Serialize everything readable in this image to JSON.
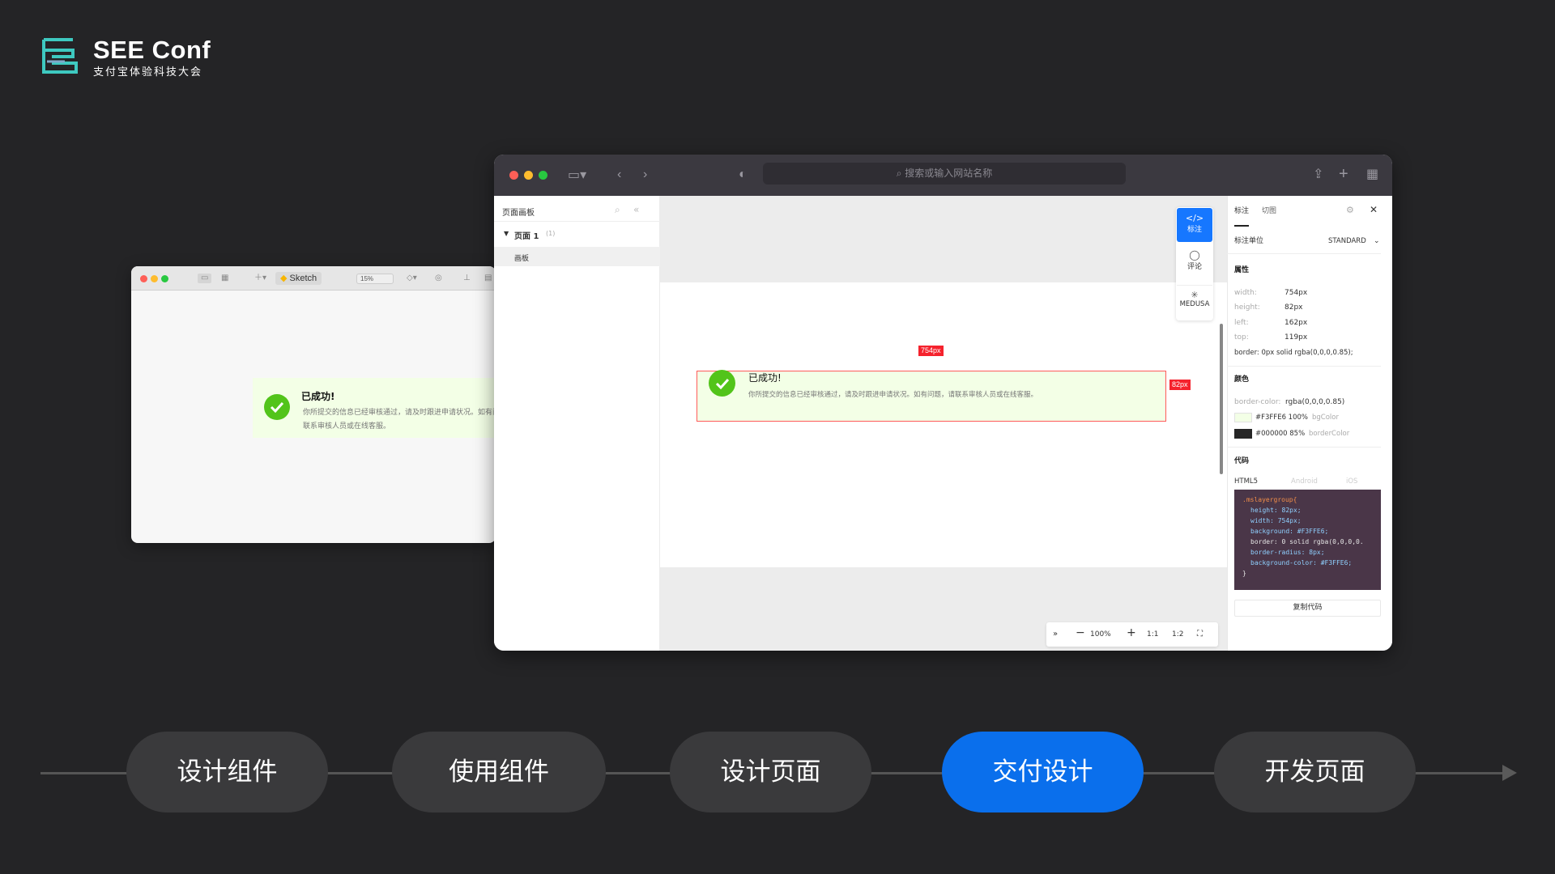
{
  "brand": {
    "title": "SEE Conf",
    "subtitle": "支付宝体验科技大会",
    "accent": "#3ec9c0"
  },
  "sketch_window": {
    "app_label": "Sketch",
    "zoom": "15%",
    "alert": {
      "title": "已成功!",
      "desc_line1": "你所提交的信息已经审核通过，请及时跟进申请状况。如有问",
      "desc_line2": "联系审核人员或在线客服。"
    }
  },
  "browser": {
    "url_placeholder": "搜索或输入网站名称",
    "left_panel": {
      "title": "页面画板",
      "page_name": "页面 1",
      "page_count": "(1)",
      "artboard_item": "画板"
    },
    "canvas": {
      "alert_title": "已成功!",
      "alert_desc": "你所提交的信息已经审核通过，请及时跟进申请状况。如有问题，请联系审核人员或在线客服。",
      "width_tag": "754px",
      "height_tag": "82px"
    },
    "tools": [
      {
        "label": "标注",
        "icon": "code-icon"
      },
      {
        "label": "评论",
        "icon": "comment-icon"
      },
      {
        "label": "MEDUSA",
        "icon": "medusa-icon"
      }
    ],
    "zoom_bar": {
      "zoom": "100%",
      "ratio1": "1:1",
      "ratio2": "1:2"
    },
    "right_panel": {
      "tabs": [
        "标注",
        "切图"
      ],
      "unit_label": "标注单位",
      "unit_value": "STANDARD",
      "props_title": "属性",
      "props": [
        {
          "k": "width:",
          "v": "754px"
        },
        {
          "k": "height:",
          "v": "82px"
        },
        {
          "k": "left:",
          "v": "162px"
        },
        {
          "k": "top:",
          "v": "119px"
        }
      ],
      "border_line": "border: 0px solid rgba(0,0,0,0.85);",
      "colors_title": "颜色",
      "border_color_key": "border-color:",
      "border_color_value": "rgba(0,0,0,0.85)",
      "swatches": [
        {
          "hex": "#F3FFE6",
          "text": "#F3FFE6 100%",
          "name": "bgColor",
          "color": "#F3FFE6"
        },
        {
          "hex": "#000000",
          "text": "#000000 85%",
          "name": "borderColor",
          "color": "#262626"
        }
      ],
      "code_title": "代码",
      "code_tabs": [
        "HTML5",
        "Android",
        "iOS"
      ],
      "code_lines": [
        ".mslayergroup{",
        "height: 82px;",
        "width: 754px;",
        "background: #F3FFE6;",
        "border: 0 solid rgba(0,0,0,0.",
        "border-radius: 8px;",
        "background-color: #F3FFE6;",
        "}"
      ],
      "copy_label": "复制代码"
    }
  },
  "pipeline": {
    "steps": [
      "设计组件",
      "使用组件",
      "设计页面",
      "交付设计",
      "开发页面"
    ],
    "active_index": 3,
    "active_color": "#0a6fec"
  }
}
